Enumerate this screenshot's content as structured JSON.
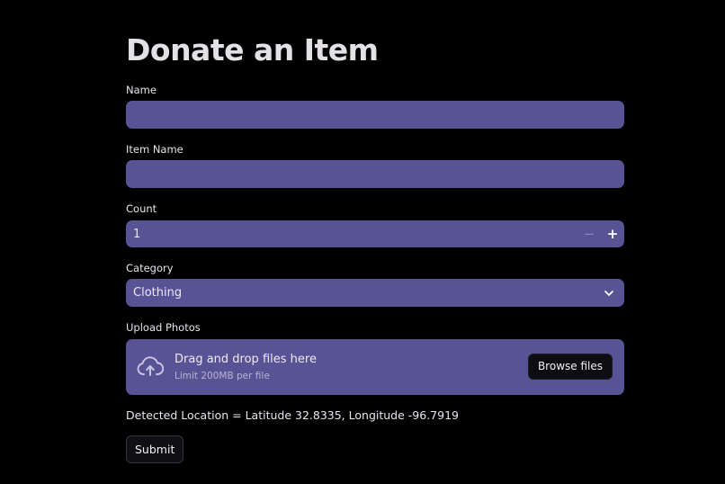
{
  "page": {
    "title": "Donate an Item"
  },
  "form": {
    "name": {
      "label": "Name",
      "value": "",
      "placeholder": ""
    },
    "item_name": {
      "label": "Item Name",
      "value": "",
      "placeholder": ""
    },
    "count": {
      "label": "Count",
      "value": "1",
      "decrement_symbol": "−",
      "increment_symbol": "+"
    },
    "category": {
      "label": "Category",
      "selected": "Clothing",
      "icon": "chevron-down-icon"
    },
    "upload": {
      "label": "Upload Photos",
      "drop_text": "Drag and drop files here",
      "limit_text": "Limit 200MB per file",
      "browse_label": "Browse files",
      "icon": "cloud-upload-icon"
    },
    "location_text": "Detected Location = Latitude 32.8335, Longitude -96.7919",
    "submit_label": "Submit"
  },
  "colors": {
    "background": "#000000",
    "field_bg": "#585394",
    "button_bg": "#0f0f14"
  }
}
